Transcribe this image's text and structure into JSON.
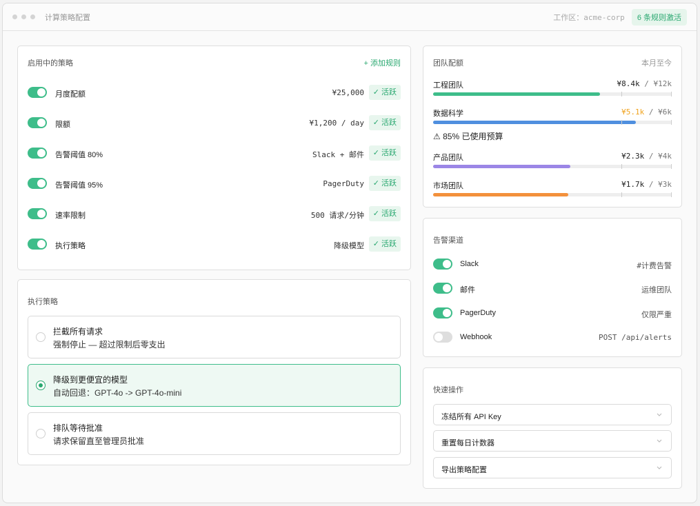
{
  "window": {
    "title": "计算策略配置",
    "workspace_label": "工作区：acme-corp",
    "active_rules_badge": "6 条规则激活"
  },
  "policies": {
    "title": "启用中的策略",
    "add_label": "+ 添加规则",
    "items": [
      {
        "name": "月度配额",
        "value": "¥25,000",
        "status": "✓ 活跃",
        "enabled": true
      },
      {
        "name": "限额",
        "value": "¥1,200 / day",
        "status": "✓ 活跃",
        "enabled": true
      },
      {
        "name": "告警阈值 80%",
        "value": "Slack + 邮件",
        "status": "✓ 活跃",
        "enabled": true
      },
      {
        "name": "告警阈值 95%",
        "value": "PagerDuty",
        "status": "✓ 活跃",
        "enabled": true
      },
      {
        "name": "速率限制",
        "value": "500 请求/分钟",
        "status": "✓ 活跃",
        "enabled": true
      },
      {
        "name": "执行策略",
        "value": "降级模型",
        "status": "✓ 活跃",
        "enabled": true
      }
    ]
  },
  "enforcement": {
    "title": "执行策略",
    "options": [
      {
        "title": "拦截所有请求",
        "desc": "强制停止 — 超过限制后零支出",
        "selected": false
      },
      {
        "title": "降级到更便宜的模型",
        "desc": "自动回退：GPT-4o -> GPT-4o-mini",
        "selected": true
      },
      {
        "title": "排队等待批准",
        "desc": "请求保留直至管理员批准",
        "selected": false
      }
    ]
  },
  "teams": {
    "title": "团队配额",
    "period": "本月至今",
    "items": [
      {
        "name": "工程团队",
        "used": "¥8.4k",
        "separator": " / ",
        "cap": "¥12k",
        "fraction": 0.7,
        "color": "#3ebd8a",
        "warn": false
      },
      {
        "name": "数据科学",
        "used": "¥5.1k",
        "separator": " / ",
        "cap": "¥6k",
        "fraction": 0.85,
        "color": "#4f8fdf",
        "warn": true,
        "warning": "⚠ 85% 已使用预算"
      },
      {
        "name": "产品团队",
        "used": "¥2.3k",
        "separator": " / ",
        "cap": "¥4k",
        "fraction": 0.575,
        "color": "#9b86e6",
        "warn": false
      },
      {
        "name": "市场团队",
        "used": "¥1.7k",
        "separator": " / ",
        "cap": "¥3k",
        "fraction": 0.567,
        "color": "#f3913c",
        "warn": false
      }
    ]
  },
  "channels": {
    "title": "告警渠道",
    "items": [
      {
        "name": "Slack",
        "target": "#计费告警",
        "enabled": true
      },
      {
        "name": "邮件",
        "target": "运维团队",
        "enabled": true
      },
      {
        "name": "PagerDuty",
        "target": "仅限严重",
        "enabled": true
      },
      {
        "name": "Webhook",
        "target": "POST /api/alerts",
        "enabled": false
      }
    ]
  },
  "quick_actions": {
    "title": "快速操作",
    "items": [
      {
        "label": "冻结所有 API Key"
      },
      {
        "label": "重置每日计数器"
      },
      {
        "label": "导出策略配置"
      }
    ]
  }
}
